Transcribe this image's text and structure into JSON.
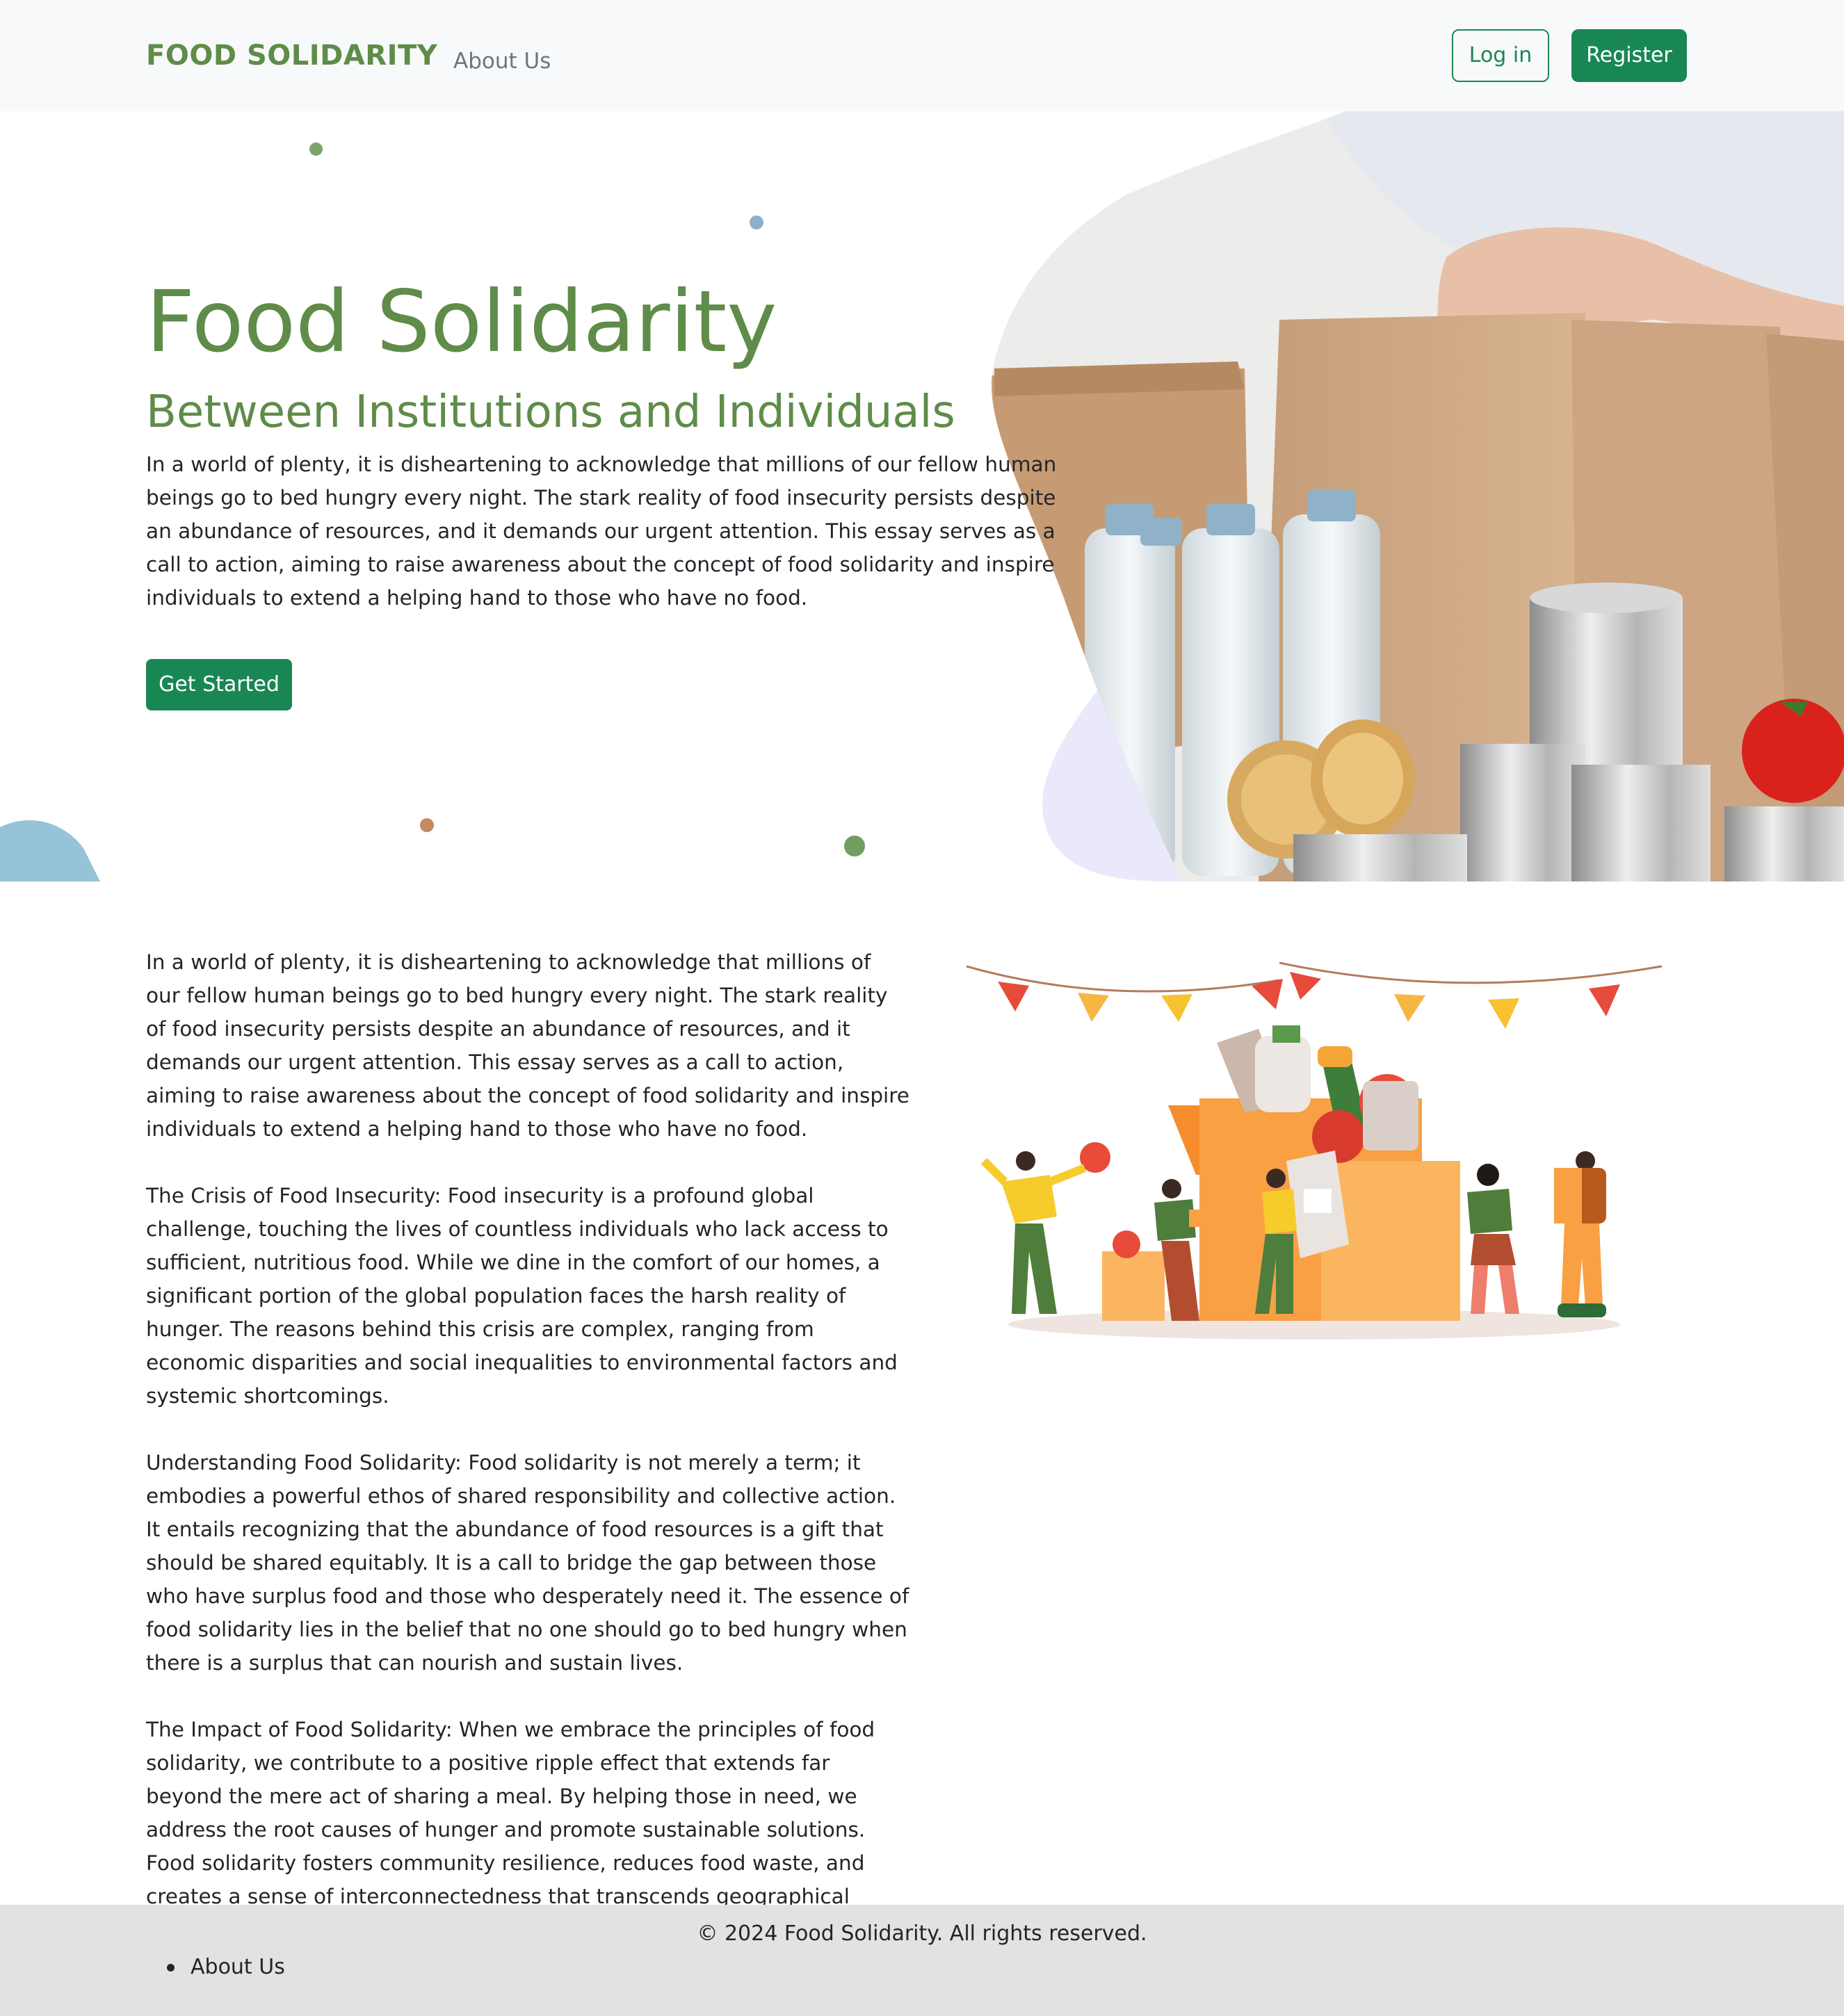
{
  "navbar": {
    "brand": "FOOD SOLIDARITY",
    "links": [
      {
        "label": "About Us"
      }
    ],
    "login_label": "Log in",
    "register_label": "Register"
  },
  "hero": {
    "title": "Food Solidarity",
    "subtitle": "Between Institutions and Individuals",
    "text": "In a world of plenty, it is disheartening to acknowledge that millions of our fellow human beings go to bed hungry every night. The stark reality of food insecurity persists despite an abundance of resources, and it demands our urgent attention. This essay serves as a call to action, aiming to raise awareness about the concept of food solidarity and inspire individuals to extend a helping hand to those who have no food.",
    "cta_label": "Get Started"
  },
  "content": {
    "paragraphs": [
      "In a world of plenty, it is disheartening to acknowledge that millions of our fellow human beings go to bed hungry every night. The stark reality of food insecurity persists despite an abundance of resources, and it demands our urgent attention. This essay serves as a call to action, aiming to raise awareness about the concept of food solidarity and inspire individuals to extend a helping hand to those who have no food.",
      "The Crisis of Food Insecurity: Food insecurity is a profound global challenge, touching the lives of countless individuals who lack access to sufficient, nutritious food. While we dine in the comfort of our homes, a significant portion of the global population faces the harsh reality of hunger. The reasons behind this crisis are complex, ranging from economic disparities and social inequalities to environmental factors and systemic shortcomings.",
      "Understanding Food Solidarity: Food solidarity is not merely a term; it embodies a powerful ethos of shared responsibility and collective action. It entails recognizing that the abundance of food resources is a gift that should be shared equitably. It is a call to bridge the gap between those who have surplus food and those who desperately need it. The essence of food solidarity lies in the belief that no one should go to bed hungry when there is a surplus that can nourish and sustain lives.",
      "The Impact of Food Solidarity: When we embrace the principles of food solidarity, we contribute to a positive ripple effect that extends far beyond the mere act of sharing a meal. By helping those in need, we address the root causes of hunger and promote sustainable solutions. Food solidarity fosters community resilience, reduces food waste, and creates a sense of interconnectedness that transcends geographical boundaries."
    ]
  },
  "footer": {
    "copyright": "© 2024 Food Solidarity. All rights reserved.",
    "links": [
      {
        "label": "About Us"
      }
    ]
  },
  "colors": {
    "brand_green": "#5f8c49",
    "button_green": "#198754",
    "navbar_bg": "#f8f9fa",
    "footer_bg": "#e2e2e2",
    "text": "#212529",
    "muted": "#6c757d"
  },
  "icons": [
    "hero-photo-food-donation",
    "community-food-illustration"
  ]
}
